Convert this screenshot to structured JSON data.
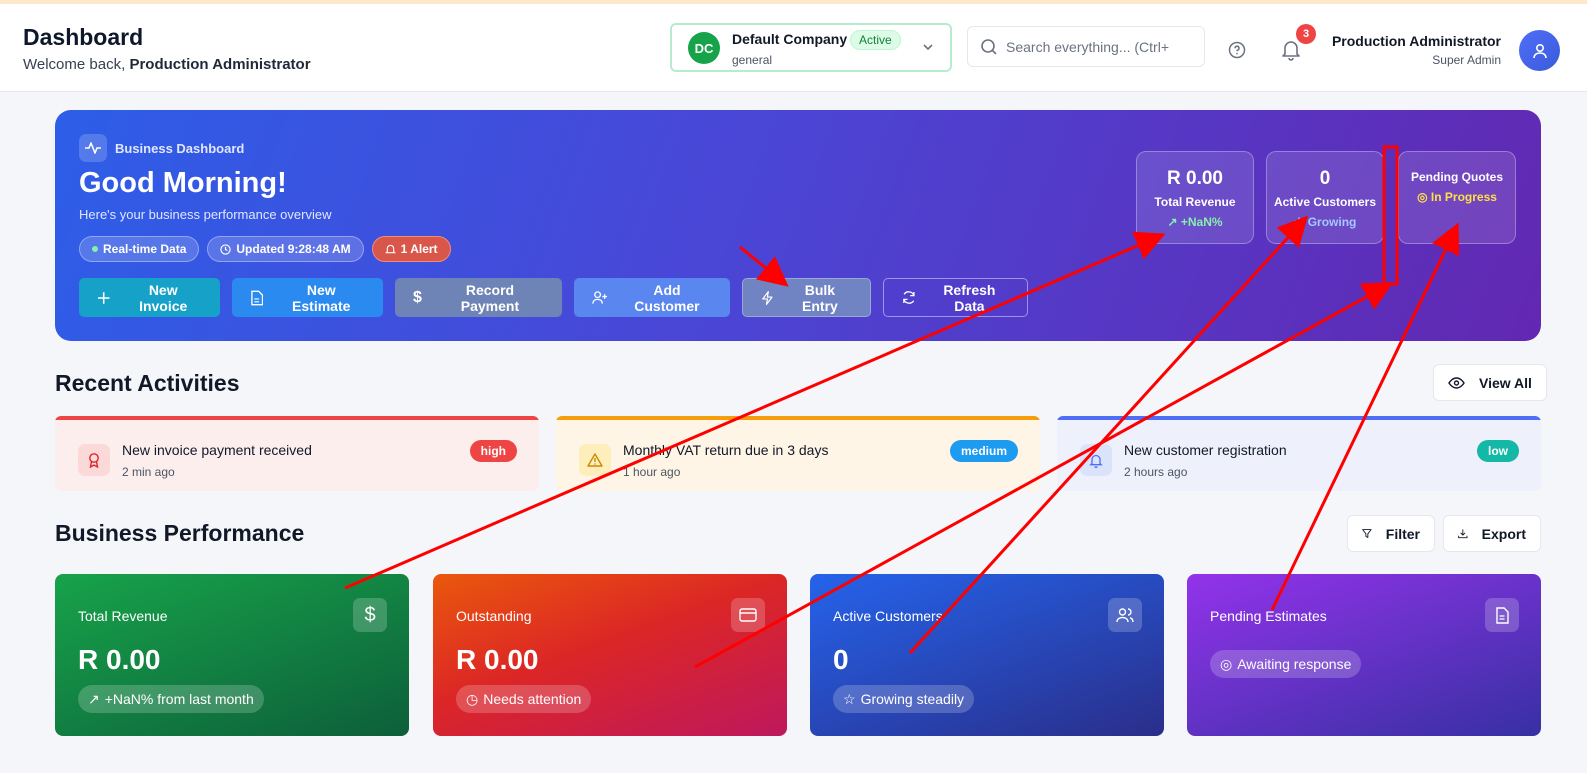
{
  "header": {
    "title": "Dashboard",
    "welcome_prefix": "Welcome back, ",
    "welcome_name": "Production Administrator",
    "company": {
      "initials": "DC",
      "name": "Default Company",
      "status": "Active",
      "sub": "general"
    },
    "search_placeholder": "Search everything... (Ctrl+",
    "notification_count": "3",
    "user_name": "Production Administrator",
    "user_role": "Super Admin"
  },
  "hero": {
    "tag": "Business Dashboard",
    "greeting": "Good Morning!",
    "subtitle": "Here's your business performance overview",
    "pills": {
      "realtime": "Real-time Data",
      "updated": "Updated 9:28:48 AM",
      "alert": "1 Alert"
    },
    "actions": {
      "new_invoice": "New Invoice",
      "new_estimate": "New Estimate",
      "record_payment": "Record Payment",
      "add_customer": "Add Customer",
      "bulk_entry": "Bulk Entry",
      "refresh_data": "Refresh Data"
    },
    "stats": {
      "revenue": {
        "value": "R 0.00",
        "label": "Total Revenue",
        "trend": "+NaN%"
      },
      "customers": {
        "value": "0",
        "label": "Active Customers",
        "trend": "Growing"
      },
      "quotes": {
        "label": "Pending Quotes",
        "trend": "In Progress"
      }
    }
  },
  "recent": {
    "title": "Recent Activities",
    "view_all": "View All",
    "items": [
      {
        "title": "New invoice payment received",
        "time": "2 min ago",
        "level": "high"
      },
      {
        "title": "Monthly VAT return due in 3 days",
        "time": "1 hour ago",
        "level": "medium"
      },
      {
        "title": "New customer registration",
        "time": "2 hours ago",
        "level": "low"
      }
    ]
  },
  "performance": {
    "title": "Business Performance",
    "filter": "Filter",
    "export": "Export",
    "cards": [
      {
        "label": "Total Revenue",
        "value": "R 0.00",
        "chip": "+NaN% from last month"
      },
      {
        "label": "Outstanding",
        "value": "R 0.00",
        "chip": "Needs attention"
      },
      {
        "label": "Active Customers",
        "value": "0",
        "chip": "Growing steadily"
      },
      {
        "label": "Pending Estimates",
        "chip": "Awaiting response"
      }
    ]
  },
  "colors": {
    "annotation": "#ff0000",
    "high": "#ef4444",
    "medium": "#1d9bf0",
    "low": "#14b8a6"
  }
}
